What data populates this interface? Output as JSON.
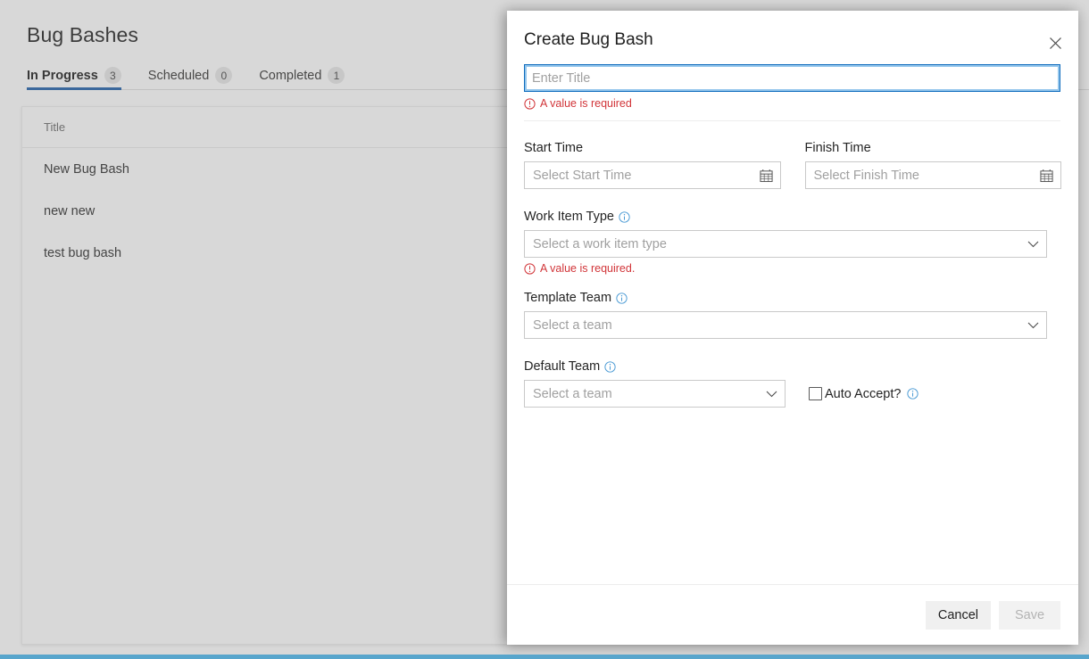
{
  "page": {
    "title": "Bug Bashes",
    "tabs": [
      {
        "label": "In Progress",
        "count": "3",
        "active": true
      },
      {
        "label": "Scheduled",
        "count": "0",
        "active": false
      },
      {
        "label": "Completed",
        "count": "1",
        "active": false
      }
    ],
    "table": {
      "columns": [
        "Title"
      ],
      "rows": [
        {
          "title": "New Bug Bash"
        },
        {
          "title": "new new"
        },
        {
          "title": "test bug bash"
        }
      ]
    }
  },
  "dialog": {
    "title": "Create Bug Bash",
    "close_icon": "close-icon",
    "title_field": {
      "placeholder": "Enter Title",
      "value": "",
      "error": "A value is required"
    },
    "start_time": {
      "label": "Start Time",
      "placeholder": "Select Start Time",
      "icon": "calendar-icon"
    },
    "finish_time": {
      "label": "Finish Time",
      "placeholder": "Select Finish Time",
      "icon": "calendar-icon"
    },
    "work_item_type": {
      "label": "Work Item Type",
      "placeholder": "Select a work item type",
      "error": "A value is required.",
      "icon": "chevron-down-icon",
      "info_icon": "info-icon"
    },
    "template_team": {
      "label": "Template Team",
      "placeholder": "Select a team",
      "icon": "chevron-down-icon",
      "info_icon": "info-icon"
    },
    "default_team": {
      "label": "Default Team",
      "placeholder": "Select a team",
      "icon": "chevron-down-icon",
      "info_icon": "info-icon"
    },
    "auto_accept": {
      "label": "Auto Accept?",
      "checked": false,
      "info_icon": "info-icon"
    },
    "footer": {
      "cancel_label": "Cancel",
      "save_label": "Save"
    }
  },
  "colors": {
    "accent": "#1f5fa9",
    "focus_border": "#0f6cbd",
    "error": "#d13438",
    "info": "#4a9ad4",
    "status_strip": "#57a5cc"
  }
}
